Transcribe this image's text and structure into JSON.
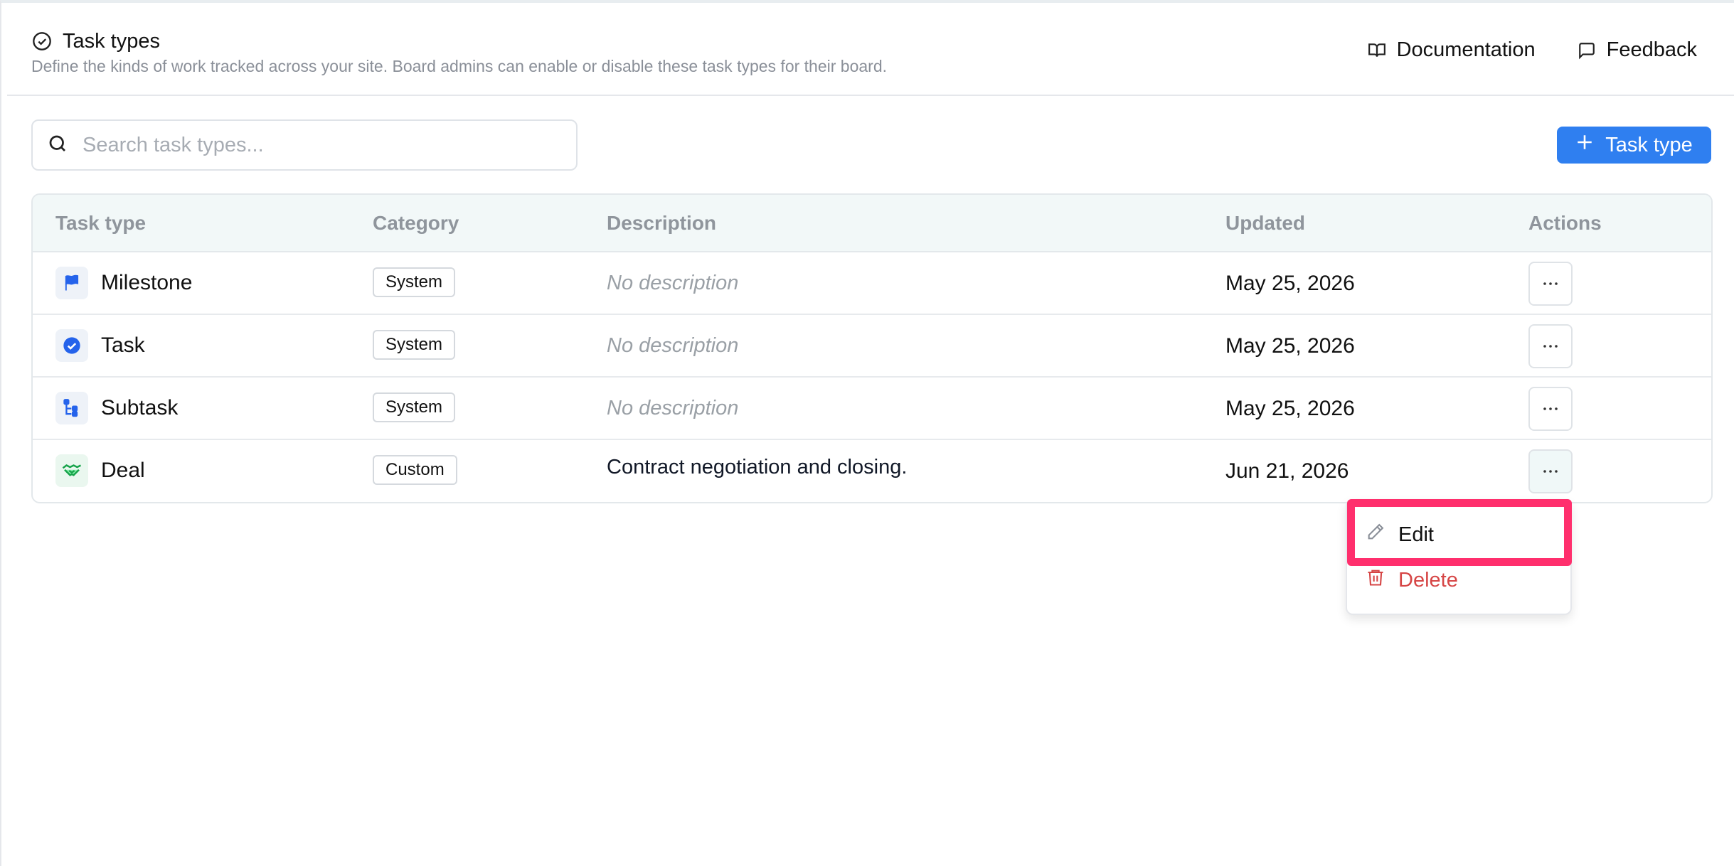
{
  "header": {
    "title": "Task types",
    "subtitle": "Define the kinds of work tracked across your site. Board admins can enable or disable these task types for their board.",
    "links": [
      {
        "label": "Documentation",
        "icon": "book-open-icon"
      },
      {
        "label": "Feedback",
        "icon": "message-square-icon"
      }
    ]
  },
  "search": {
    "placeholder": "Search task types..."
  },
  "add_button": {
    "label": "Task type",
    "color": "#2f7ff0"
  },
  "table": {
    "columns": [
      "Task type",
      "Category",
      "Description",
      "Updated",
      "Actions"
    ],
    "rows": [
      {
        "name": "Milestone",
        "icon": "flag-icon",
        "icon_color": "#2563eb",
        "category": "System",
        "description": "No description",
        "description_empty": true,
        "updated": "May 25, 2026"
      },
      {
        "name": "Task",
        "icon": "check-circle-icon",
        "icon_color": "#2563eb",
        "category": "System",
        "description": "No description",
        "description_empty": true,
        "updated": "May 25, 2026"
      },
      {
        "name": "Subtask",
        "icon": "subtask-tree-icon",
        "icon_color": "#2563eb",
        "category": "System",
        "description": "No description",
        "description_empty": true,
        "updated": "May 25, 2026"
      },
      {
        "name": "Deal",
        "icon": "handshake-icon",
        "icon_color": "#16a34a",
        "category": "Custom",
        "description": "Contract negotiation and closing.",
        "description_empty": false,
        "updated": "Jun 21, 2026"
      }
    ]
  },
  "menu": {
    "items": [
      {
        "label": "Edit",
        "icon": "pencil-icon"
      },
      {
        "label": "Delete",
        "icon": "trash-icon",
        "color": "#d64545"
      }
    ]
  },
  "colors": {
    "highlight": "#ff2f6d"
  }
}
